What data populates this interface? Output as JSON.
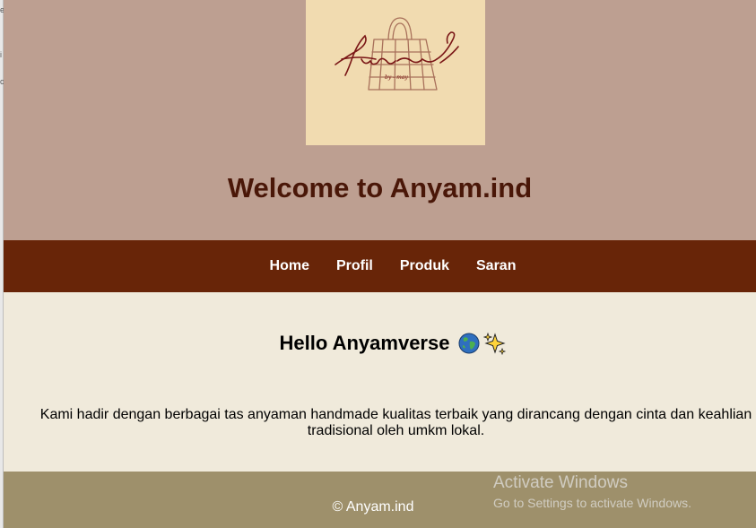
{
  "site": {
    "title": "Welcome to Anyam.ind",
    "logo": {
      "wordmark": "Anyamind",
      "tagline": "by - may",
      "background": "#f1dbb0"
    }
  },
  "nav": {
    "items": [
      {
        "label": "Home"
      },
      {
        "label": "Profil"
      },
      {
        "label": "Produk"
      },
      {
        "label": "Saran"
      }
    ]
  },
  "content": {
    "greeting": "Hello Anyamverse",
    "greeting_icons": [
      "globe-icon",
      "sparkles-icon"
    ],
    "about": "Kami hadir dengan berbagai tas anyaman handmade kualitas terbaik yang dirancang dengan cinta dan keahlian tradisional oleh umkm lokal."
  },
  "footer": {
    "copyright": "© Anyam.ind"
  },
  "watermark": {
    "title": "Activate Windows",
    "subtitle": "Go to Settings to activate Windows."
  },
  "colors": {
    "header_bg": "#bd9f91",
    "nav_bg": "#682508",
    "content_bg": "#f0eadb",
    "footer_bg": "#9e906b",
    "title_text": "#4a1708"
  }
}
